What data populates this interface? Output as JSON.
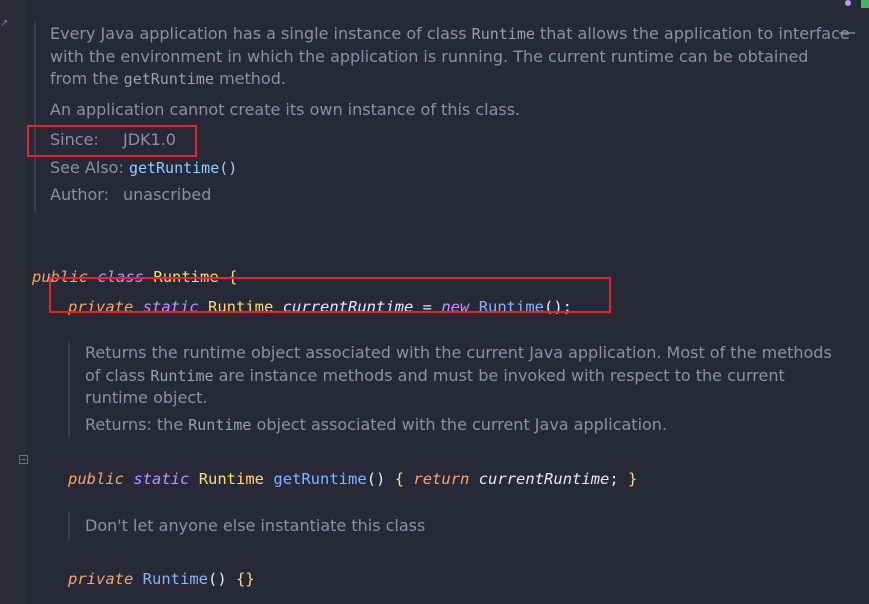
{
  "doc1": {
    "p1_a": "Every Java application has a single instance of class ",
    "p1_code": "Runtime",
    "p1_b": " that allows the application to interface with the environment in which the application is running. The current runtime can be obtained from the ",
    "p1_code2": "getRuntime",
    "p1_c": " method.",
    "p2": "An application cannot create its own instance of this class.",
    "since_label": "Since:",
    "since_value": "JDK1.0",
    "seealso_label": "See Also:",
    "seealso_link": "getRuntime()",
    "author_label": "Author:",
    "author_value": "unascribed"
  },
  "code": {
    "class_decl": {
      "kw1": "public",
      "kw2": "class",
      "name": "Runtime",
      "brace": " {"
    },
    "field": {
      "kw1": "private",
      "kw2": "static",
      "type": "Runtime",
      "name": "currentRuntime",
      "eq": " = ",
      "kw3": "new",
      "ctor": "Runtime",
      "end": "();"
    },
    "method": {
      "kw1": "public",
      "kw2": "static",
      "type": "Runtime",
      "name": "getRuntime",
      "parens": "() ",
      "open": "{",
      "ret": "return",
      "val": "currentRuntime",
      "semi": "; ",
      "close": "}"
    },
    "ctor": {
      "kw1": "private",
      "name": "Runtime",
      "parens": "() ",
      "body": "{}"
    }
  },
  "doc2": {
    "p_a": "Returns the runtime object associated with the current Java application. Most of the methods of class ",
    "p_code": "Runtime",
    "p_b": " are instance methods and must be invoked with respect to the current runtime object.",
    "ret_a": "Returns: the ",
    "ret_code": "Runtime",
    "ret_b": " object associated with the current Java application."
  },
  "doc3": {
    "text": "Don't let anyone else instantiate this class"
  }
}
